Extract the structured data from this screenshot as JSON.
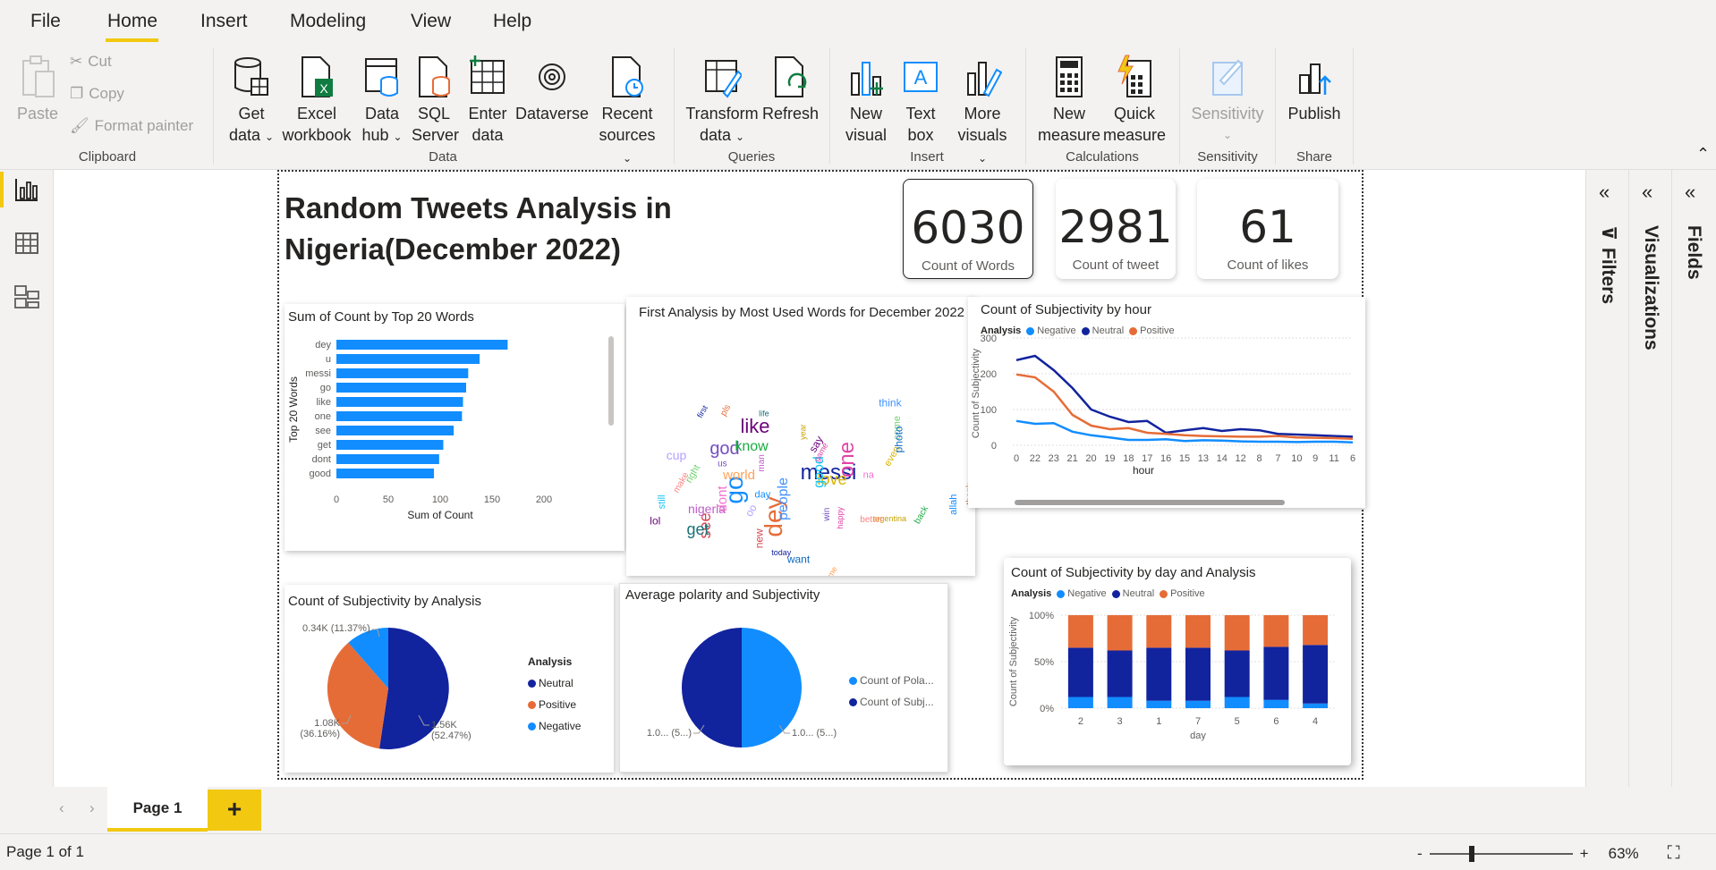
{
  "menu": {
    "items": [
      "File",
      "Home",
      "Insert",
      "Modeling",
      "View",
      "Help"
    ]
  },
  "ribbon": {
    "clipboard": {
      "paste": "Paste",
      "cut": "Cut",
      "copy": "Copy",
      "format_painter": "Format painter",
      "label": "Clipboard"
    },
    "data": {
      "get_data": [
        "Get",
        "data"
      ],
      "excel": [
        "Excel",
        "workbook"
      ],
      "data_hub": [
        "Data",
        "hub"
      ],
      "sql": [
        "SQL",
        "Server"
      ],
      "enter_data": [
        "Enter",
        "data"
      ],
      "dataverse": "Dataverse",
      "recent": [
        "Recent",
        "sources"
      ],
      "label": "Data"
    },
    "queries": {
      "transform": [
        "Transform",
        "data"
      ],
      "refresh": "Refresh",
      "label": "Queries"
    },
    "insert": {
      "new_visual": [
        "New",
        "visual"
      ],
      "text_box": [
        "Text",
        "box"
      ],
      "more_visuals": [
        "More",
        "visuals"
      ],
      "label": "Insert"
    },
    "calculations": {
      "new_measure": [
        "New",
        "measure"
      ],
      "quick_measure": [
        "Quick",
        "measure"
      ],
      "label": "Calculations"
    },
    "sensitivity": {
      "sensitivity": "Sensitivity",
      "label": "Sensitivity"
    },
    "share": {
      "publish": "Publish",
      "label": "Share"
    }
  },
  "report": {
    "title_line1": "Random Tweets Analysis in",
    "title_line2": "Nigeria(December 2022)",
    "cards": [
      {
        "value": "6030",
        "label": "Count of  Words"
      },
      {
        "value": "2981",
        "label": "Count of tweet"
      },
      {
        "value": "61",
        "label": "Count of likes"
      }
    ],
    "wordcloud_title": "First Analysis by Most Used Words for December 2022",
    "wordcloud_words": [
      "messi",
      "dey",
      "go",
      "like",
      "one",
      "god",
      "love",
      "see",
      "get",
      "know",
      "good",
      "people",
      "world",
      "nigeria",
      "dont",
      "cup",
      "argentina",
      "make",
      "come",
      "want",
      "first",
      "thank",
      "day",
      "say",
      "happy",
      "us",
      "even",
      "new",
      "life",
      "back",
      "still",
      "think",
      "time",
      "man",
      "na",
      "oo",
      "year",
      "better",
      "right",
      "photo",
      "today",
      "pls",
      "allah",
      "lol",
      "game",
      "win"
    ],
    "legend_title": "Analysis"
  },
  "chart_data": [
    {
      "type": "bar",
      "title": "Sum of Count by Top 20 Words",
      "orientation": "horizontal",
      "categories": [
        "dey",
        "u",
        "messi",
        "go",
        "like",
        "one",
        "see",
        "get",
        "dont",
        "good"
      ],
      "values": [
        165,
        138,
        127,
        125,
        122,
        121,
        113,
        103,
        99,
        94
      ],
      "xlabel": "Sum of Count",
      "ylabel": "Top 20 Words",
      "xlim": [
        0,
        200
      ],
      "xticks": [
        0,
        50,
        100,
        150,
        200
      ]
    },
    {
      "type": "line",
      "title": "Count of Subjectivity by hour",
      "xlabel": "hour",
      "ylabel": "Count of Subjectivity",
      "legend_title": "Analysis",
      "categories": [
        "0",
        "22",
        "23",
        "21",
        "20",
        "19",
        "18",
        "17",
        "16",
        "15",
        "13",
        "14",
        "12",
        "8",
        "7",
        "10",
        "9",
        "11",
        "6"
      ],
      "ylim": [
        0,
        300
      ],
      "yticks": [
        0,
        100,
        200,
        300
      ],
      "series": [
        {
          "name": "Negative",
          "color": "#118dff",
          "values": [
            68,
            60,
            62,
            38,
            28,
            22,
            15,
            15,
            17,
            12,
            14,
            13,
            11,
            10,
            10,
            9,
            10,
            10,
            8
          ]
        },
        {
          "name": "Neutral",
          "color": "#12239e",
          "values": [
            238,
            250,
            210,
            160,
            100,
            80,
            65,
            68,
            35,
            42,
            48,
            40,
            45,
            42,
            32,
            30,
            28,
            26,
            24
          ]
        },
        {
          "name": "Positive",
          "color": "#e66c37",
          "values": [
            198,
            190,
            150,
            85,
            55,
            45,
            48,
            35,
            32,
            28,
            26,
            25,
            24,
            24,
            26,
            22,
            21,
            20,
            18
          ]
        }
      ]
    },
    {
      "type": "pie",
      "title": "Count of Subjectivity by Analysis",
      "legend_title": "Analysis",
      "slices": [
        {
          "name": "Neutral",
          "value": 1.56,
          "pct": 52.47,
          "color": "#12239e",
          "label": "1.56K",
          "pct_label": "(52.47%)"
        },
        {
          "name": "Positive",
          "value": 1.08,
          "pct": 36.16,
          "color": "#e66c37",
          "label": "1.08K",
          "pct_label": "(36.16%)"
        },
        {
          "name": "Negative",
          "value": 0.34,
          "pct": 11.37,
          "color": "#118dff",
          "label": "0.34K (11.37%)",
          "pct_label": ""
        }
      ]
    },
    {
      "type": "pie",
      "title": "Average polarity and Subjectivity",
      "slices": [
        {
          "name": "Count of Pola...",
          "value": 50,
          "color": "#118dff",
          "label": "1.0... (5...)"
        },
        {
          "name": "Count of Subj...",
          "value": 50,
          "color": "#12239e",
          "label": "1.0... (5...)"
        }
      ]
    },
    {
      "type": "bar",
      "stacked": "100%",
      "title": "Count of Subjectivity by day and Analysis",
      "xlabel": "day",
      "ylabel": "Count of Subjectivity",
      "legend_title": "Analysis",
      "categories": [
        "2",
        "3",
        "1",
        "7",
        "5",
        "6",
        "4"
      ],
      "yticks": [
        "0%",
        "50%",
        "100%"
      ],
      "series": [
        {
          "name": "Negative",
          "color": "#118dff",
          "values": [
            12,
            12,
            8,
            8,
            12,
            9,
            5
          ]
        },
        {
          "name": "Neutral",
          "color": "#12239e",
          "values": [
            53,
            50,
            57,
            57,
            50,
            57,
            63
          ]
        },
        {
          "name": "Positive",
          "color": "#e66c37",
          "values": [
            35,
            38,
            35,
            35,
            38,
            34,
            32
          ]
        }
      ]
    }
  ],
  "panes": {
    "filters": "Filters",
    "visualizations": "Visualizations",
    "fields": "Fields"
  },
  "tabs": {
    "page": "Page 1",
    "add": "+"
  },
  "status": {
    "page_count": "Page 1 of 1",
    "zoom": "63%"
  },
  "colors": {
    "accent": "#f2c811",
    "negative": "#118dff",
    "neutral": "#12239e",
    "positive": "#e66c37"
  }
}
